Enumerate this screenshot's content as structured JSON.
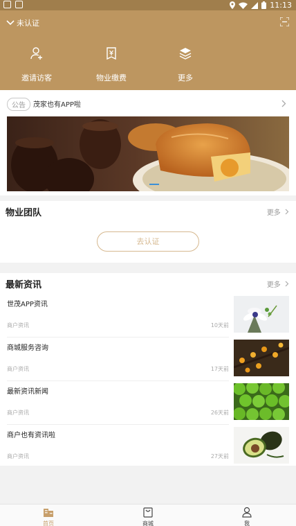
{
  "status_bar": {
    "time": "11:13"
  },
  "header": {
    "auth_label": "未认证",
    "quick_actions": [
      {
        "label": "邀请访客",
        "icon": "user-add-icon"
      },
      {
        "label": "物业缴费",
        "icon": "bill-icon"
      },
      {
        "label": "更多",
        "icon": "layers-icon"
      }
    ]
  },
  "notice": {
    "tag": "公告",
    "text": "茂家也有APP啦"
  },
  "property_team": {
    "title": "物业团队",
    "more": "更多",
    "auth_button": "去认证"
  },
  "news": {
    "title": "最新资讯",
    "more": "更多",
    "items": [
      {
        "title": "世茂APP资讯",
        "source": "商户资讯",
        "date": "10天前",
        "image": "flower-photo"
      },
      {
        "title": "商城服务咨询",
        "source": "商户资讯",
        "date": "17天前",
        "image": "fruit-branch-photo"
      },
      {
        "title": "最新资讯新闻",
        "source": "商户资讯",
        "date": "26天前",
        "image": "green-fruit-photo"
      },
      {
        "title": "商户也有资讯啦",
        "source": "商户资讯",
        "date": "27天前",
        "image": "avocado-photo"
      }
    ]
  },
  "tabbar": {
    "tabs": [
      {
        "label": "首页",
        "icon": "home-icon",
        "active": true
      },
      {
        "label": "商城",
        "icon": "shopping-bag-icon",
        "active": false
      },
      {
        "label": "我",
        "icon": "person-icon",
        "active": false
      }
    ]
  },
  "colors": {
    "header_bg": "#bd9660",
    "accent": "#c79f6b",
    "status_bar_bg": "#a07e4c"
  }
}
